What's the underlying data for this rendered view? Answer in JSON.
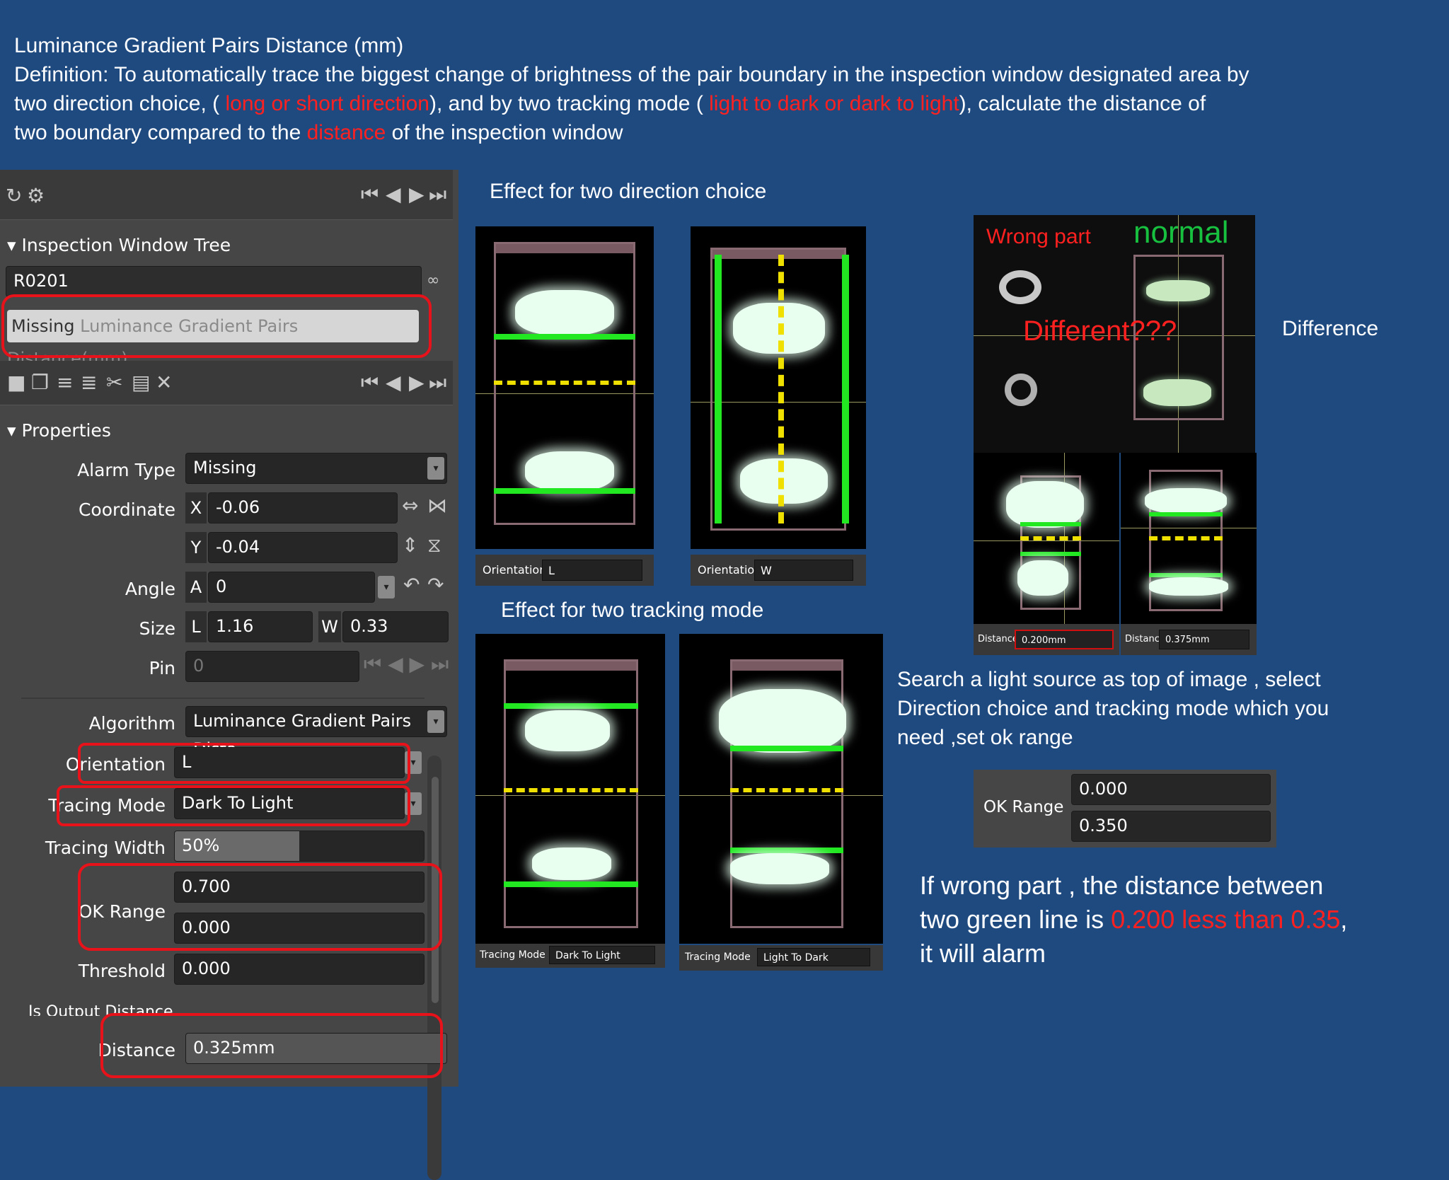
{
  "header": {
    "title": "Luminance Gradient Pairs Distance (mm)",
    "def_1": "Definition:  To automatically trace the biggest change of brightness of the pair boundary in the inspection window designated area by",
    "def_2a": "two direction choice, ( ",
    "def_2b": "long or short direction",
    "def_2c": "), and by two tracking mode ( ",
    "def_2d": "light to dark or dark to light",
    "def_2e": "), calculate   the distance of",
    "def_3a": "two boundary compared to the ",
    "def_3b": "distance",
    "def_3c": " of the inspection window"
  },
  "panel": {
    "tree_title": "Inspection Window Tree",
    "tree_item": "R0201",
    "missing_tag": "Missing",
    "missing_text": "Luminance Gradient Pairs Distance(mm)",
    "properties_title": "Properties",
    "alarm_type_label": "Alarm Type",
    "alarm_type_value": "Missing",
    "coordinate_label": "Coordinate",
    "x_tag": "X",
    "x_value": "-0.06",
    "y_tag": "Y",
    "y_value": "-0.04",
    "angle_label": "Angle",
    "a_tag": "A",
    "a_value": "0",
    "size_label": "Size",
    "l_tag": "L",
    "l_value": "1.16",
    "w_tag": "W",
    "w_value": "0.33",
    "pin_label": "Pin",
    "pin_value": "0",
    "algorithm_label": "Algorithm",
    "algorithm_value": "Luminance Gradient Pairs Dista",
    "orientation_label": "Orientation",
    "orientation_value": "L",
    "tracing_mode_label": "Tracing Mode",
    "tracing_mode_value": "Dark To Light",
    "tracing_width_label": "Tracing Width",
    "tracing_width_value": "50%",
    "tracing_width_fill": 0.5,
    "ok_range_label": "OK Range",
    "ok_range_max": "0.700",
    "ok_range_min": "0.000",
    "threshold_label": "Threshold",
    "threshold_value": "0.000",
    "is_output_label": "Is Output Distance",
    "check": "✓",
    "distance_label": "Distance",
    "distance_value": "0.325mm"
  },
  "direction": {
    "caption": "Effect for two direction choice",
    "orientation_label": "Orientation",
    "left_value": "L",
    "right_value": "W"
  },
  "tracking": {
    "caption": "Effect for two tracking mode",
    "label": "Tracing Mode",
    "left_value": "Dark To Light",
    "right_value": "Light To Dark"
  },
  "compare": {
    "wrong_part": "Wrong part",
    "normal": "normal",
    "different": "Different???",
    "difference": "Difference",
    "distance_label": "Distance",
    "left_distance": "0.200mm",
    "right_distance": "0.375mm"
  },
  "notes": {
    "search_1": "Search a light source as top of  image , select",
    "search_2": "Direction choice and tracking mode which you",
    "search_3": "need ,set ok range",
    "ok_label": "OK Range",
    "ok_max": "0.000",
    "ok_min": "0.350",
    "wrong_1": "If wrong part , the distance between",
    "wrong_2a": "two green line is ",
    "wrong_2b": "0.200 less than 0.35",
    "wrong_2c": ",",
    "wrong_3": "it will alarm"
  }
}
